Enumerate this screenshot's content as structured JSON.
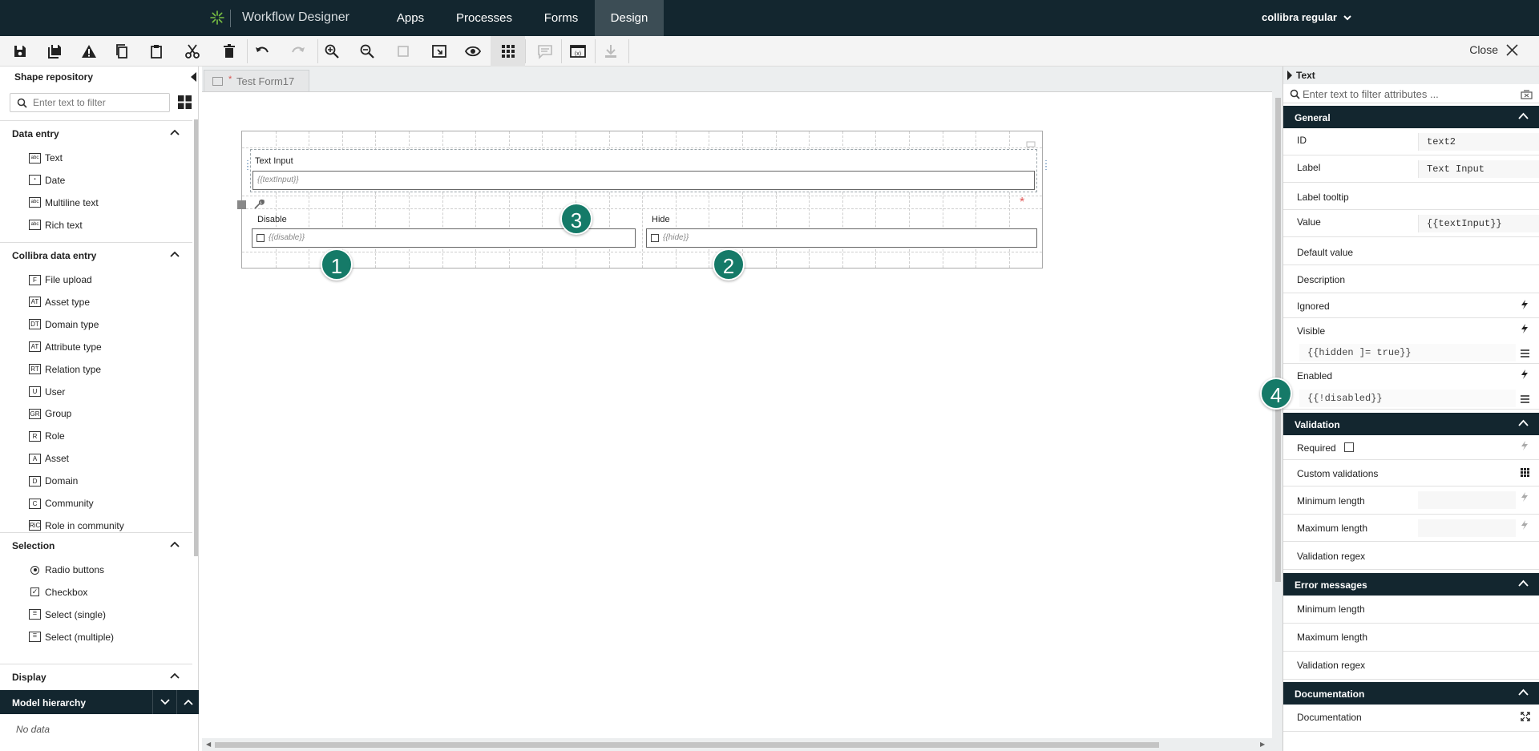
{
  "nav": {
    "app_title": "Workflow Designer",
    "tabs": [
      "Apps",
      "Processes",
      "Forms",
      "Design"
    ],
    "active_tab": "Design",
    "user": "collibra regular"
  },
  "toolbar": {
    "buttons": [
      "save-icon",
      "save-all-icon",
      "warning-icon",
      "copy-icon",
      "paste-icon",
      "cut-icon",
      "delete-icon",
      "undo-icon",
      "redo-icon",
      "zoom-in-icon",
      "zoom-out-icon",
      "checkbox-icon",
      "fit-icon",
      "preview-icon",
      "grid-icon",
      "comment-icon",
      "variables-icon",
      "download-icon"
    ],
    "close_label": "Close"
  },
  "left_panel": {
    "title": "Shape repository",
    "filter_placeholder": "Enter text to filter",
    "sections": [
      {
        "title": "Data entry",
        "items": [
          {
            "label": "Text",
            "icon": "abc"
          },
          {
            "label": "Date",
            "icon": "date"
          },
          {
            "label": "Multiline text",
            "icon": "abc"
          },
          {
            "label": "Rich text",
            "icon": "abc"
          }
        ]
      },
      {
        "title": "Collibra data entry",
        "items": [
          {
            "label": "File upload",
            "icon": "F"
          },
          {
            "label": "Asset type",
            "icon": "AT"
          },
          {
            "label": "Domain type",
            "icon": "DT"
          },
          {
            "label": "Attribute type",
            "icon": "AT"
          },
          {
            "label": "Relation type",
            "icon": "RT"
          },
          {
            "label": "User",
            "icon": "U"
          },
          {
            "label": "Group",
            "icon": "GR"
          },
          {
            "label": "Role",
            "icon": "R"
          },
          {
            "label": "Asset",
            "icon": "A"
          },
          {
            "label": "Domain",
            "icon": "D"
          },
          {
            "label": "Community",
            "icon": "C"
          },
          {
            "label": "Role in community",
            "icon": "RiC"
          }
        ]
      },
      {
        "title": "Selection",
        "items": [
          {
            "label": "Radio buttons",
            "icon": "radio"
          },
          {
            "label": "Checkbox",
            "icon": "check"
          },
          {
            "label": "Select (single)",
            "icon": "select"
          },
          {
            "label": "Select (multiple)",
            "icon": "select"
          }
        ]
      },
      {
        "title": "Display",
        "items": []
      }
    ],
    "model_hierarchy": {
      "title": "Model hierarchy",
      "empty_text": "No data"
    }
  },
  "canvas": {
    "tab_label": "Test Form17",
    "tab_modified_marker": "*",
    "form": {
      "text_field": {
        "label": "Text Input",
        "value": "{{textInput}}"
      },
      "disable_field": {
        "label": "Disable",
        "value": "{{disable}}"
      },
      "hide_field": {
        "label": "Hide",
        "value": "{{hide}}"
      },
      "required_marker": "*"
    },
    "badges": [
      "1",
      "2",
      "3",
      "4"
    ]
  },
  "right_panel": {
    "title": "Text",
    "filter_placeholder": "Enter text to filter attributes ...",
    "general": {
      "title": "General",
      "id_label": "ID",
      "id_value": "text2",
      "label_label": "Label",
      "label_value": "Text Input",
      "tooltip_label": "Label tooltip",
      "value_label": "Value",
      "value_value": "{{textInput}}",
      "default_label": "Default value",
      "description_label": "Description",
      "ignored_label": "Ignored",
      "visible_label": "Visible",
      "visible_expr": "{{hidden ]= true}}",
      "enabled_label": "Enabled",
      "enabled_expr": "{{!disabled}}"
    },
    "validation": {
      "title": "Validation",
      "required_label": "Required",
      "custom_label": "Custom validations",
      "min_label": "Minimum length",
      "max_label": "Maximum length",
      "regex_label": "Validation regex"
    },
    "errors": {
      "title": "Error messages",
      "min_label": "Minimum length",
      "max_label": "Maximum length",
      "regex_label": "Validation regex"
    },
    "documentation": {
      "title": "Documentation",
      "label": "Documentation"
    }
  }
}
